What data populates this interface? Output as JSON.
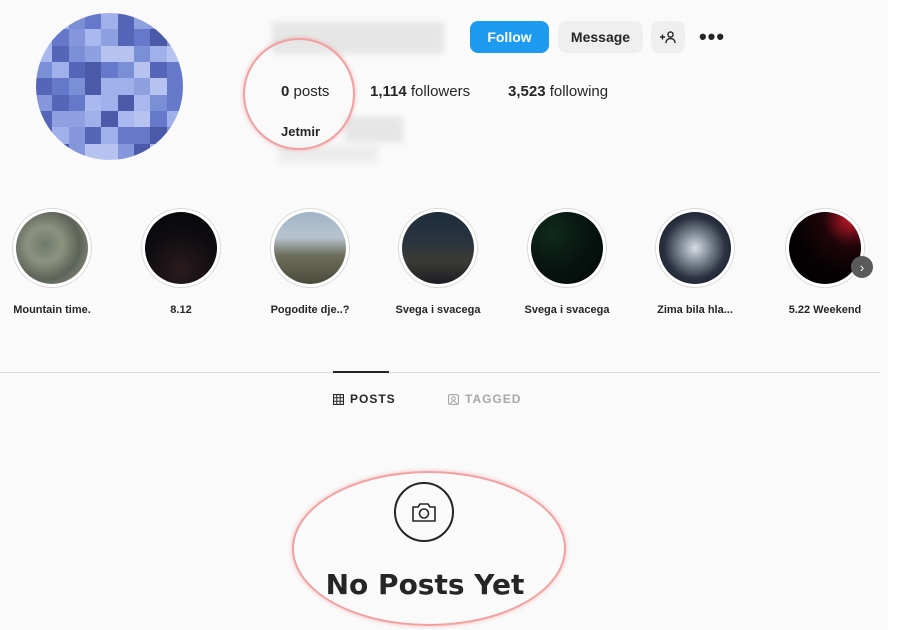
{
  "profile": {
    "full_name": "Jetmir",
    "stats": {
      "posts_count": "0",
      "posts_label": "posts",
      "followers_count": "1,114",
      "followers_label": "followers",
      "following_count": "3,523",
      "following_label": "following"
    }
  },
  "actions": {
    "follow_label": "Follow",
    "message_label": "Message",
    "add_user_label": "+°",
    "more_label": "•••"
  },
  "highlights": [
    {
      "label": "Mountain time.",
      "icon": "highlight-cover"
    },
    {
      "label": "8.12",
      "icon": "highlight-cover"
    },
    {
      "label": "Pogodite dje..?",
      "icon": "highlight-cover"
    },
    {
      "label": "Svega i svacega",
      "icon": "highlight-cover"
    },
    {
      "label": "Svega i svacega",
      "icon": "highlight-cover"
    },
    {
      "label": "Zima bila hla...",
      "icon": "highlight-cover"
    },
    {
      "label": "5.22 Weekend",
      "icon": "highlight-cover"
    }
  ],
  "highlights_next_label": "›",
  "tabs": [
    {
      "label": "POSTS",
      "icon": "grid-icon",
      "active": true
    },
    {
      "label": "TAGGED",
      "icon": "tagged-icon",
      "active": false
    }
  ],
  "empty_state": {
    "title": "No Posts Yet",
    "icon": "camera-icon"
  },
  "colors": {
    "follow_button": "#1d9bf0",
    "secondary_button": "#efefef",
    "annotation": "#f2a0a0",
    "background": "#fafafa"
  }
}
